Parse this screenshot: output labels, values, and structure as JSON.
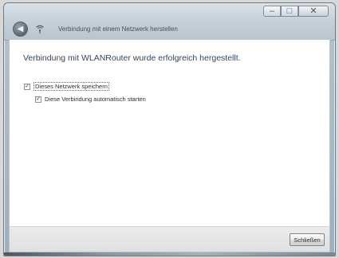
{
  "window": {
    "title": "Verbindung mit einem Netzwerk herstellen",
    "controls": {
      "minimize": "–",
      "maximize": "□",
      "close": "✕"
    },
    "icons": {
      "back": "back-arrow-icon",
      "network": "network-connection-icon"
    }
  },
  "main": {
    "heading": "Verbindung mit WLANRouter wurde erfolgreich hergestellt.",
    "options": [
      {
        "label": "Dieses Netzwerk speichern",
        "checked": true
      },
      {
        "label": "Diese Verbindung automatisch starten",
        "checked": true
      }
    ]
  },
  "footer": {
    "close_button": "Schließen"
  },
  "colors": {
    "heading_text": "#33465e",
    "window_frame": "#b9c5ce",
    "content_background": "#ffffff"
  }
}
